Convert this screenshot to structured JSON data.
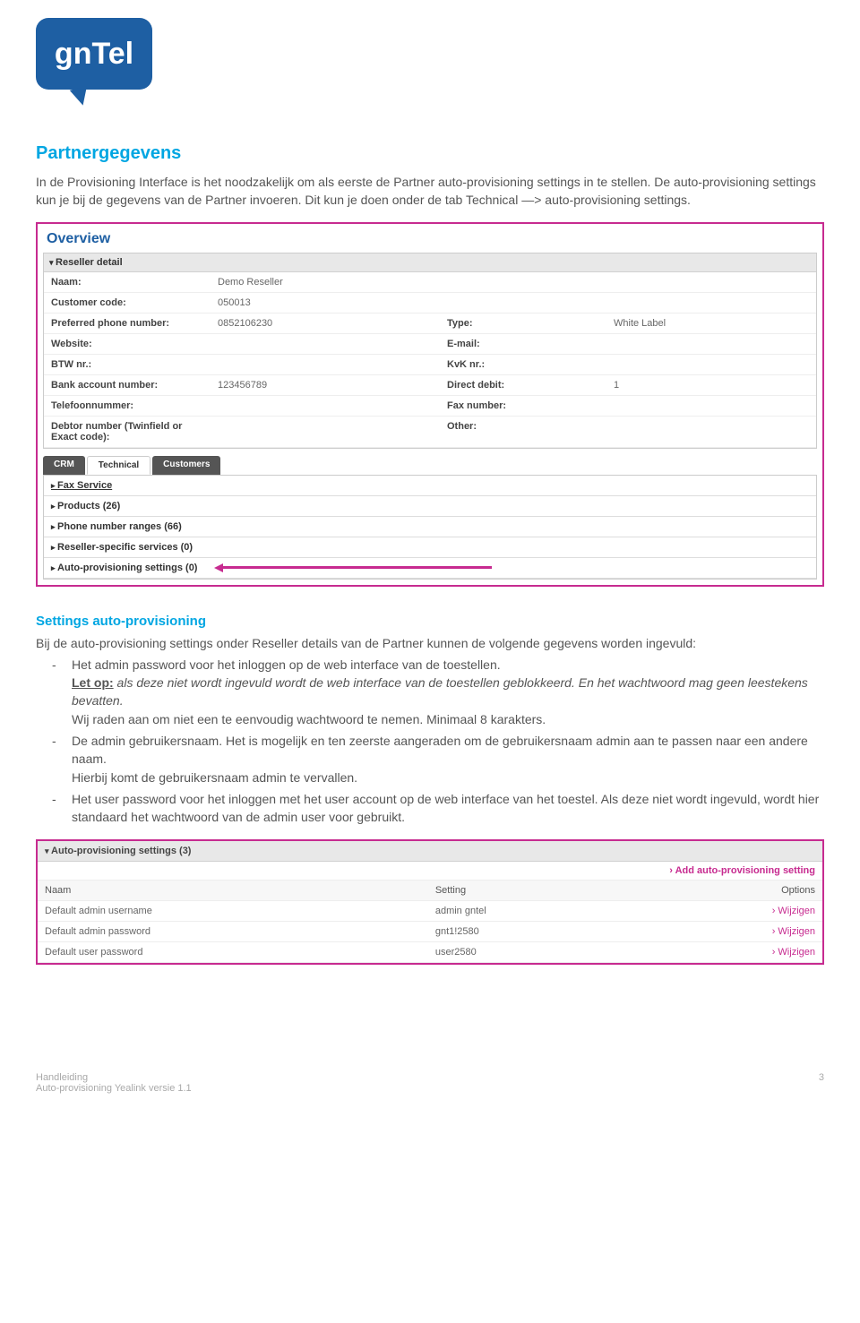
{
  "logo_text": "gnTel",
  "h1": "Partnergegevens",
  "intro_p1": "In de Provisioning Interface is het noodzakelijk om als eerste de Partner auto-provisioning settings in te stellen. De auto-provisioning settings kun je bij de gegevens van de Partner invoeren. Dit kun je doen onder de tab Technical ―> auto-provisioning settings.",
  "overview": {
    "title": "Overview",
    "detail_header": "Reseller detail",
    "rows": [
      {
        "l": "Naam:",
        "v": "Demo Reseller",
        "l2": "",
        "v2": ""
      },
      {
        "l": "Customer code:",
        "v": "050013",
        "l2": "",
        "v2": ""
      },
      {
        "l": "Preferred phone number:",
        "v": "0852106230",
        "l2": "Type:",
        "v2": "White Label"
      },
      {
        "l": "Website:",
        "v": "",
        "l2": "E-mail:",
        "v2": ""
      },
      {
        "l": "BTW nr.:",
        "v": "",
        "l2": "KvK nr.:",
        "v2": ""
      },
      {
        "l": "Bank account number:",
        "v": "123456789",
        "l2": "Direct debit:",
        "v2": "1"
      },
      {
        "l": "Telefoonnummer:",
        "v": "",
        "l2": "Fax number:",
        "v2": ""
      },
      {
        "l": "Debtor number (Twinfield or Exact code):",
        "v": "",
        "l2": "Other:",
        "v2": ""
      }
    ],
    "tabs": [
      "CRM",
      "Technical",
      "Customers"
    ],
    "collapsibles": [
      {
        "label": "Fax Service",
        "underline": true
      },
      {
        "label": "Products (26)"
      },
      {
        "label": "Phone number ranges (66)"
      },
      {
        "label": "Reseller-specific services (0)"
      },
      {
        "label": "Auto-provisioning settings (0)",
        "arrow": true
      }
    ]
  },
  "subhead": "Settings auto-provisioning",
  "sub_p": "Bij de auto-provisioning settings onder Reseller details van de Partner kunnen de volgende gegevens worden ingevuld:",
  "bullets": {
    "b1_a": "Het admin password voor het inloggen op de web interface van de toestellen.",
    "b1_letop": "Let op:",
    "b1_b": " als deze niet wordt ingevuld wordt de web interface van de toestellen geblokkeerd. En het wachtwoord mag geen leestekens bevatten.",
    "b1_c": "Wij raden aan om niet een te eenvoudig wachtwoord te nemen. Minimaal 8 karakters.",
    "b2": "De admin gebruikersnaam. Het is mogelijk en ten zeerste aangeraden om de gebruikersnaam admin aan te passen naar een andere naam.",
    "b2_b": "Hierbij komt de gebruikersnaam admin te vervallen.",
    "b3": "Het user password voor het inloggen met het user account op de web interface van het toestel. Als deze niet wordt ingevuld, wordt hier standaard het wachtwoord van de admin user voor gebruikt."
  },
  "aps": {
    "header": "Auto-provisioning settings (3)",
    "add": "Add auto-provisioning setting",
    "cols": {
      "naam": "Naam",
      "setting": "Setting",
      "options": "Options"
    },
    "wijzigen": "Wijzigen",
    "rows": [
      {
        "naam": "Default admin username",
        "setting": "admin gntel"
      },
      {
        "naam": "Default admin password",
        "setting": "gnt1!2580"
      },
      {
        "naam": "Default user password",
        "setting": "user2580"
      }
    ]
  },
  "footer": {
    "l1": "Handleiding",
    "l2": "Auto-provisioning  Yealink versie 1.1",
    "page": "3"
  }
}
